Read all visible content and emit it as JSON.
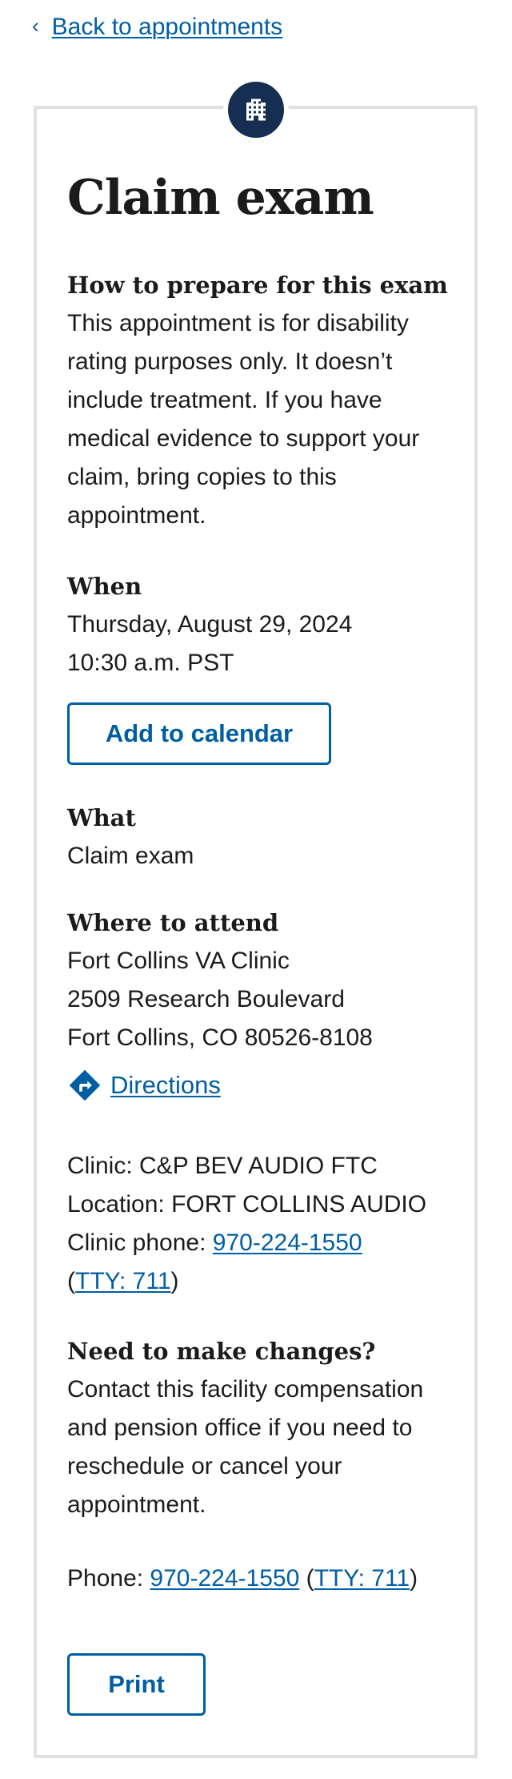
{
  "nav": {
    "back_chevron": "‹",
    "back_label": "Back to appointments"
  },
  "card": {
    "icon": "building-icon",
    "title": "Claim exam",
    "prepare": {
      "heading": "How to prepare for this exam",
      "lines": [
        "This appointment is for disability",
        "rating purposes only. It doesn’t",
        "include treatment. If you have",
        "medical evidence to support your",
        "claim, bring copies to this",
        "appointment."
      ]
    },
    "when": {
      "heading": "When",
      "date": "Thursday, August 29, 2024",
      "time": "10:30 a.m. PST",
      "calendar_button": "Add to calendar"
    },
    "what": {
      "heading": "What",
      "value": "Claim exam"
    },
    "where": {
      "heading": "Where to attend",
      "facility": "Fort Collins VA Clinic",
      "street": "2509 Research Boulevard",
      "city_state_zip": "Fort Collins, CO 80526-8108",
      "directions_icon": "directions-icon",
      "directions_label": "Directions",
      "clinic_line": "Clinic: C&P BEV AUDIO FTC",
      "location_line": "Location: FORT COLLINS AUDIO",
      "clinic_phone_label": "Clinic phone: ",
      "clinic_phone": "970-224-1550",
      "tty_open": "(",
      "tty": "TTY: 711",
      "tty_close": ")"
    },
    "changes": {
      "heading": "Need to make changes?",
      "lines": [
        "Contact this facility compensation",
        "and pension office if you need to",
        "reschedule or cancel your",
        "appointment."
      ],
      "phone_label": "Phone: ",
      "phone": "970-224-1550",
      "tty_open": " (",
      "tty": "TTY: 711",
      "tty_close": ")"
    },
    "print_button": "Print"
  },
  "colors": {
    "link": "#005ea2",
    "icon_bg": "#162e51",
    "border": "#dfe1e2",
    "text": "#1b1b1b"
  }
}
